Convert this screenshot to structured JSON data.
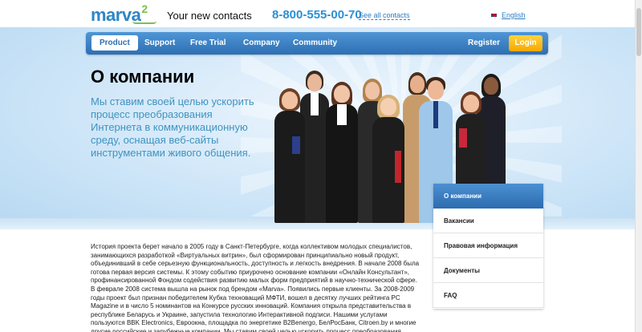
{
  "header": {
    "logo_text": "marva",
    "logo_superscript": "2",
    "tagline": "Your new contacts",
    "phone": "8-800-555-00-70",
    "see_all_contacts": "See all contacts",
    "language": "English"
  },
  "nav": {
    "items": [
      "Product",
      "Support",
      "Free Trial",
      "Company",
      "Community"
    ],
    "active": "Product",
    "register_label": "Register",
    "login_label": "Login"
  },
  "hero": {
    "title": "О компании",
    "text": "Мы ставим своей целью ускорить процесс преобразования Интернета в коммуникационную среду, оснащая веб-сайты инструментами живого общения."
  },
  "side_menu": {
    "items": [
      "О компании",
      "Вакансии",
      "Правовая информация",
      "Документы",
      "FAQ"
    ],
    "active": "О компании"
  },
  "article": {
    "text": "История проекта берет начало в 2005 году в Санкт-Петербурге, когда коллективом молодых специалистов, занимающихся разработкой «Виртуальных витрин», был сформирован принципиально новый продукт, объединивший в себе серьезную функциональность, доступность и легкость внедрения. В начале 2008 была готова первая версия системы. К этому событию приурочено основание компании «Онлайн Консультант», профинансированной Фондом содействия развитию малых форм предприятий в научно-технической сфере. В феврале 2008 система вышла на рынок под брендом «Marva». Появились первые клиенты. За 2008-2009 годы проект был признан победителем Кубка техноващий МФТИ, вошел в десятку лучших рейтинга PC Magazine и в число 5 номинантов на Конкурсе русских инноваций. Компания открыла представительства в республике Беларусь и Украине, запустила технологию Интерактивной подписи. Нашими услугами пользуются BBK Electronics, Евроокна, площадка по энергетике B2Benergo, БелРосБанк, Citroen.by и многие другие российские и зарубежные компании. Мы ставим своей целью ускорить процесс преобразования Интернета в"
  },
  "colors": {
    "brand_blue": "#2d85c6",
    "brand_green": "#7cc04b",
    "nav_blue": "#2d6fb3",
    "login_yellow": "#f5a800",
    "hero_text": "#3f93bf"
  }
}
